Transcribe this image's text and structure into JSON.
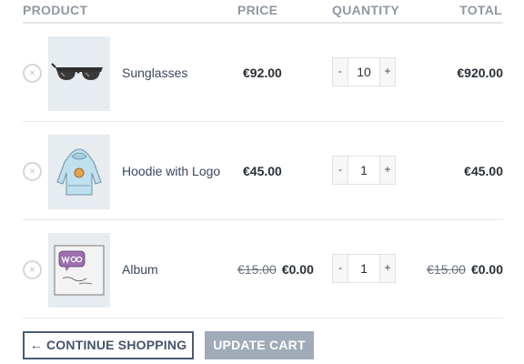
{
  "table": {
    "headers": {
      "product": "PRODUCT",
      "price": "PRICE",
      "quantity": "QUANTITY",
      "total": "TOTAL"
    },
    "rows": [
      {
        "remove_icon": "×",
        "image_icon": "sunglasses-icon",
        "name": "Sunglasses",
        "old_price": "",
        "price": "€92.00",
        "qty_minus": "-",
        "quantity": "10",
        "qty_plus": "+",
        "old_total": "",
        "total": "€920.00"
      },
      {
        "remove_icon": "×",
        "image_icon": "hoodie-icon",
        "name": "Hoodie with Logo",
        "old_price": "",
        "price": "€45.00",
        "qty_minus": "-",
        "quantity": "1",
        "qty_plus": "+",
        "old_total": "",
        "total": "€45.00"
      },
      {
        "remove_icon": "×",
        "image_icon": "album-icon",
        "name": "Album",
        "old_price": "€15.00",
        "price": "€0.00",
        "qty_minus": "-",
        "quantity": "1",
        "qty_plus": "+",
        "old_total": "€15.00",
        "total": "€0.00"
      }
    ]
  },
  "actions": {
    "continue_label": "← CONTINUE SHOPPING",
    "update_label": "UPDATE CART"
  },
  "colors": {
    "accent": "#4a5b73",
    "button_disabled": "#a0abb8",
    "header_text": "#8f98a3"
  }
}
